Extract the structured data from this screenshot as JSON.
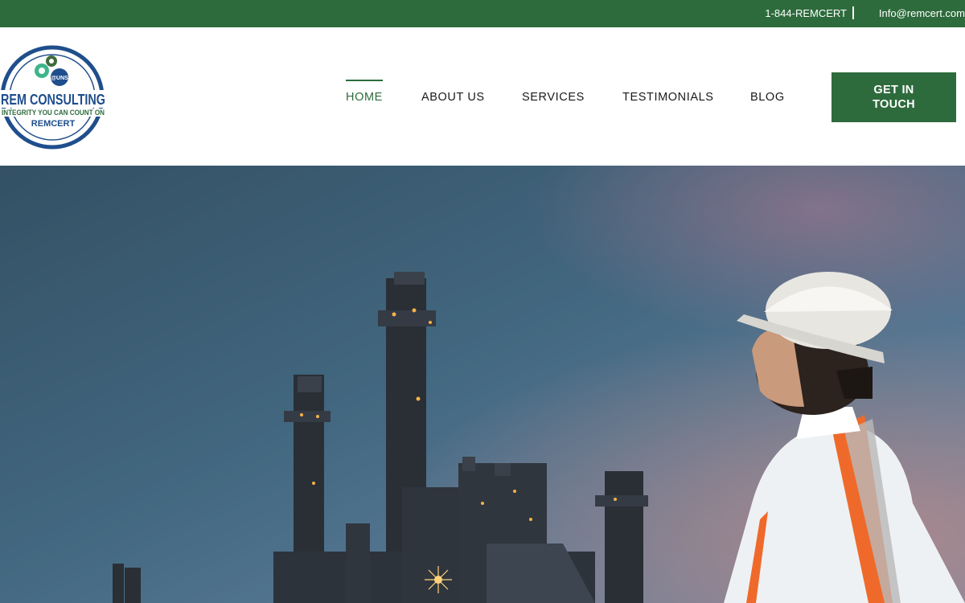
{
  "topbar": {
    "phone": "1-844-REMCERT",
    "email": "Info@remcert.com"
  },
  "logo": {
    "name": "REM CONSULTING",
    "tagline": "INTEGRITY YOU CAN COUNT ON",
    "brand": "REMCERT",
    "badge": "@UNS"
  },
  "nav": {
    "items": [
      {
        "label": "HOME",
        "active": true
      },
      {
        "label": "ABOUT US",
        "active": false
      },
      {
        "label": "SERVICES",
        "active": false
      },
      {
        "label": "TESTIMONIALS",
        "active": false
      },
      {
        "label": "BLOG",
        "active": false
      }
    ],
    "cta_label": "GET IN TOUCH"
  },
  "colors": {
    "brand_green": "#2e6b3c",
    "logo_blue": "#1f4e8c",
    "text_dark": "#1a1a1a"
  },
  "hero": {
    "image": "industrial-refinery-engineer-hardhat"
  }
}
